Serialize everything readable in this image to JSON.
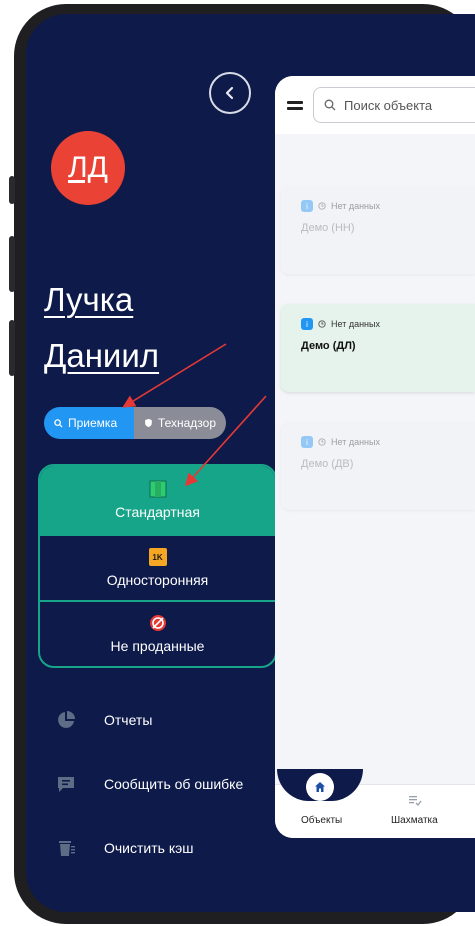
{
  "header": {
    "back_icon": "chevron-left-icon"
  },
  "user": {
    "initials": "ЛД",
    "first_name": "Лучка",
    "last_name": "Даниил"
  },
  "mode_toggle": {
    "active_label": "Приемка",
    "inactive_label": "Технадзор",
    "active_icon": "search-icon",
    "inactive_icon": "shield-icon"
  },
  "categories": [
    {
      "label": "Стандартная",
      "icon": "green-square-icon",
      "active": true
    },
    {
      "label": "Односторонняя",
      "icon": "1k-badge-icon",
      "badge_text": "1K",
      "active": false
    },
    {
      "label": "Не проданные",
      "icon": "no-sale-icon",
      "active": false
    }
  ],
  "menu": {
    "reports": "Отчеты",
    "report_error": "Сообщить об ошибке",
    "clear_cache": "Очистить кэш"
  },
  "panel": {
    "search_placeholder": "Поиск объекта",
    "objects": [
      {
        "status": "Нет данных",
        "name": "Демо (НН)"
      },
      {
        "status": "Нет данных",
        "name": "Демо (ДЛ)"
      },
      {
        "status": "Нет данных",
        "name": "Демо (ДВ)"
      }
    ],
    "badge_text": "i",
    "nav": {
      "objects": "Объекты",
      "board": "Шахматка"
    }
  },
  "colors": {
    "background": "#0d1a4a",
    "avatar": "#ea4335",
    "accent_green": "#17a589",
    "accent_blue": "#2196f3",
    "annotation_arrow": "#e53935"
  }
}
